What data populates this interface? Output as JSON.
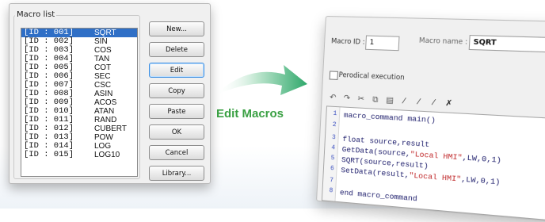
{
  "macro_list_dialog": {
    "title": "Macro list",
    "items": [
      {
        "id": "[ID : 001]",
        "name": "SQRT",
        "selected": true
      },
      {
        "id": "[ID : 002]",
        "name": "SIN"
      },
      {
        "id": "[ID : 003]",
        "name": "COS"
      },
      {
        "id": "[ID : 004]",
        "name": "TAN"
      },
      {
        "id": "[ID : 005]",
        "name": "COT"
      },
      {
        "id": "[ID : 006]",
        "name": "SEC"
      },
      {
        "id": "[ID : 007]",
        "name": "CSC"
      },
      {
        "id": "[ID : 008]",
        "name": "ASIN"
      },
      {
        "id": "[ID : 009]",
        "name": "ACOS"
      },
      {
        "id": "[ID : 010]",
        "name": "ATAN"
      },
      {
        "id": "[ID : 011]",
        "name": "RAND"
      },
      {
        "id": "[ID : 012]",
        "name": "CUBERT"
      },
      {
        "id": "[ID : 013]",
        "name": "POW"
      },
      {
        "id": "[ID : 014]",
        "name": "LOG"
      },
      {
        "id": "[ID : 015]",
        "name": "LOG10"
      }
    ],
    "buttons": {
      "new": "New...",
      "delete": "Delete",
      "edit": "Edit",
      "copy": "Copy",
      "paste": "Paste",
      "ok": "OK",
      "cancel": "Cancel",
      "library": "Library..."
    }
  },
  "caption": "Edit Macros",
  "editor_dialog": {
    "macro_id_label": "Macro ID :",
    "macro_id_value": "1",
    "macro_name_label": "Macro name :",
    "macro_name_value": "SQRT",
    "periodical_label": "Perodical execution",
    "toolbar_icons": [
      "undo-icon",
      "redo-icon",
      "cut-icon",
      "copy-icon",
      "paste-icon",
      "wand-icon",
      "wand2-icon",
      "wand3-icon",
      "wand-clear-icon"
    ],
    "code_lines": [
      {
        "n": "1",
        "text": "macro_command main()"
      },
      {
        "n": "2",
        "text": ""
      },
      {
        "n": "3",
        "text": "float source,result"
      },
      {
        "n": "4",
        "pre": "GetData(source,",
        "str": "\"Local HMI\"",
        "post": ",LW,0,1)"
      },
      {
        "n": "5",
        "text": "SQRT(source,result)"
      },
      {
        "n": "6",
        "pre": "SetData(result,",
        "str": "\"Local HMI\"",
        "post": ",LW,0,1)"
      },
      {
        "n": "7",
        "text": ""
      },
      {
        "n": "8",
        "text": "end macro_command"
      }
    ]
  },
  "colors": {
    "accent_green": "#3aa043",
    "selection_blue": "#2f6fc6"
  }
}
